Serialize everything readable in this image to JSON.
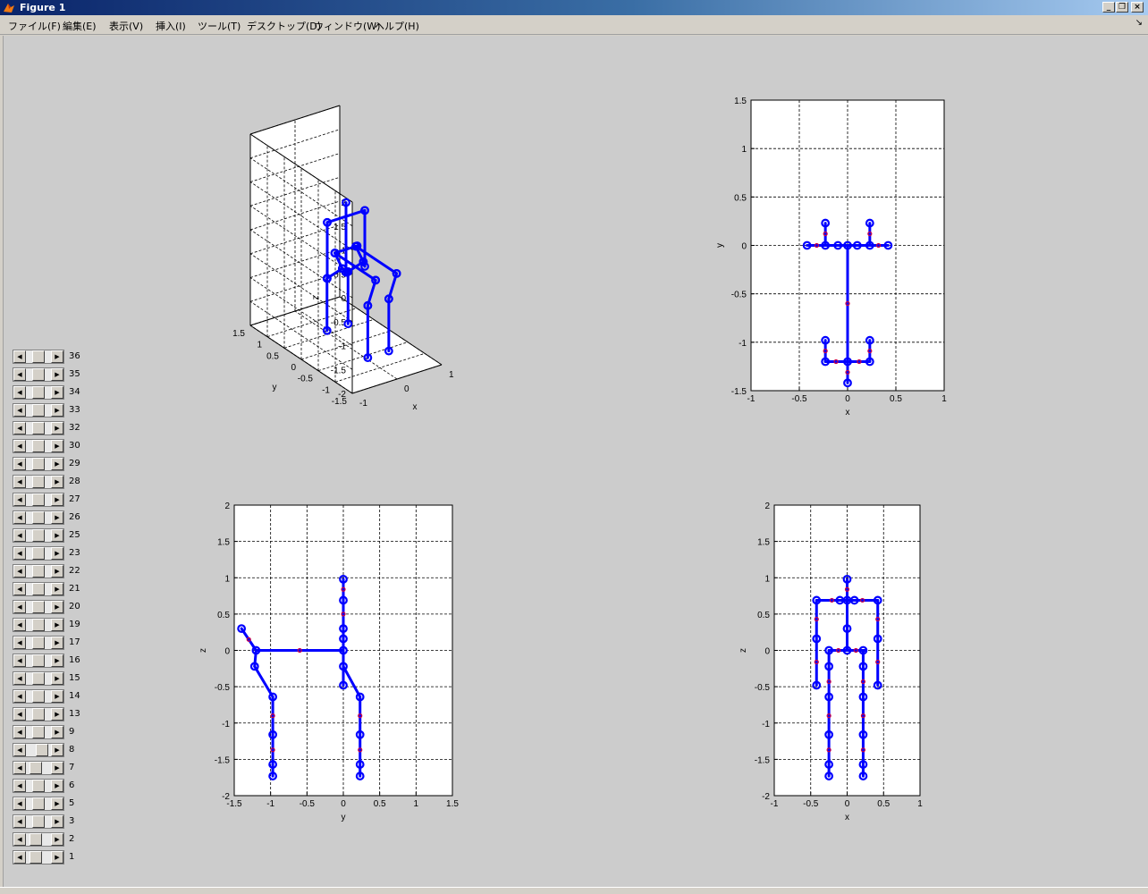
{
  "window": {
    "title": "Figure 1"
  },
  "menu": [
    "ファイル(F)",
    "編集(E)",
    "表示(V)",
    "挿入(I)",
    "ツール(T)",
    "デスクトップ(D)",
    "ウィンドウ(W)",
    "ヘルプ(H)"
  ],
  "colors": {
    "line": "#0000ff",
    "marker": "#0000ff",
    "knot": "#cc0044",
    "axes_bg": "#ffffff",
    "figure_bg": "#cccccc"
  },
  "sliders": [
    {
      "label": "36",
      "value": 0.25
    },
    {
      "label": "35",
      "value": 0.25
    },
    {
      "label": "34",
      "value": 0.25
    },
    {
      "label": "33",
      "value": 0.25
    },
    {
      "label": "32",
      "value": 0.25
    },
    {
      "label": "30",
      "value": 0.25
    },
    {
      "label": "29",
      "value": 0.25
    },
    {
      "label": "28",
      "value": 0.25
    },
    {
      "label": "27",
      "value": 0.25
    },
    {
      "label": "26",
      "value": 0.25
    },
    {
      "label": "25",
      "value": 0.25
    },
    {
      "label": "23",
      "value": 0.25
    },
    {
      "label": "22",
      "value": 0.25
    },
    {
      "label": "21",
      "value": 0.25
    },
    {
      "label": "20",
      "value": 0.25
    },
    {
      "label": "19",
      "value": 0.25
    },
    {
      "label": "17",
      "value": 0.25
    },
    {
      "label": "16",
      "value": 0.25
    },
    {
      "label": "15",
      "value": 0.25
    },
    {
      "label": "14",
      "value": 0.25
    },
    {
      "label": "13",
      "value": 0.25
    },
    {
      "label": "9",
      "value": 0.25
    },
    {
      "label": "8",
      "value": 0.4
    },
    {
      "label": "7",
      "value": 0.15
    },
    {
      "label": "6",
      "value": 0.25
    },
    {
      "label": "5",
      "value": 0.25
    },
    {
      "label": "3",
      "value": 0.25
    },
    {
      "label": "2",
      "value": 0.15
    },
    {
      "label": "1",
      "value": 0.15
    }
  ],
  "chart_data": [
    {
      "type": "scatter",
      "view": "3d",
      "xlabel": "x",
      "ylabel": "y",
      "zlabel": "z",
      "xlim": [
        -1,
        1
      ],
      "ylim": [
        -1.5,
        1.5
      ],
      "zlim": [
        -2,
        2
      ],
      "xticks": [
        "-1",
        "0",
        "1"
      ],
      "yticks": [
        "-1.5",
        "-1",
        "-0.5",
        "0",
        "0.5",
        "1",
        "1.5"
      ],
      "zticks": [
        "-2",
        "-1.5",
        "-1",
        "-0.5",
        "0",
        "0.5",
        "1",
        "1.5",
        "2"
      ],
      "grid": true,
      "points": [
        [
          -0.25,
          0,
          0
        ],
        [
          0.25,
          0,
          0
        ],
        [
          -0.35,
          -0.25,
          0.6
        ],
        [
          0.35,
          -0.25,
          0.6
        ],
        [
          0,
          -1.2,
          0.6
        ],
        [
          0,
          0,
          1
        ],
        [
          -0.25,
          -0.5,
          -1.7
        ],
        [
          0.25,
          -0.5,
          -1.7
        ],
        [
          -0.25,
          1,
          -1.5
        ],
        [
          0.25,
          1,
          -1.5
        ]
      ]
    },
    {
      "type": "line",
      "view": "top",
      "xlabel": "x",
      "ylabel": "y",
      "xlim": [
        -1,
        1
      ],
      "ylim": [
        -1.5,
        1.5
      ],
      "xticks": [
        "-1",
        "-0.5",
        "0",
        "0.5",
        "1"
      ],
      "yticks": [
        "-1.5",
        "-1",
        "-0.5",
        "0",
        "0.5",
        "1",
        "1.5"
      ],
      "grid": true,
      "segments": [
        [
          [
            -0.42,
            0
          ],
          [
            0.42,
            0
          ]
        ],
        [
          [
            -0.23,
            0
          ],
          [
            -0.23,
            0.23
          ]
        ],
        [
          [
            0.23,
            0
          ],
          [
            0.23,
            0.23
          ]
        ],
        [
          [
            0,
            0
          ],
          [
            0,
            -1.2
          ]
        ],
        [
          [
            -0.23,
            -1.2
          ],
          [
            0.23,
            -1.2
          ]
        ],
        [
          [
            -0.23,
            -1.2
          ],
          [
            -0.23,
            -0.98
          ]
        ],
        [
          [
            0.23,
            -1.2
          ],
          [
            0.23,
            -0.98
          ]
        ],
        [
          [
            0,
            -1.2
          ],
          [
            0,
            -1.42
          ]
        ]
      ],
      "markers": [
        [
          -0.42,
          0
        ],
        [
          -0.23,
          0
        ],
        [
          -0.1,
          0
        ],
        [
          0,
          0
        ],
        [
          0.1,
          0
        ],
        [
          0.23,
          0
        ],
        [
          0.42,
          0
        ],
        [
          -0.23,
          0.23
        ],
        [
          0.23,
          0.23
        ],
        [
          -0.23,
          -0.98
        ],
        [
          0.23,
          -0.98
        ],
        [
          -0.23,
          -1.2
        ],
        [
          0,
          -1.2
        ],
        [
          0.23,
          -1.2
        ],
        [
          0,
          -1.42
        ]
      ],
      "knots": [
        [
          -0.32,
          0
        ],
        [
          0.32,
          0
        ],
        [
          0,
          -0.6
        ],
        [
          -0.12,
          -1.2
        ],
        [
          0.12,
          -1.2
        ],
        [
          -0.23,
          0.12
        ],
        [
          0.23,
          0.12
        ],
        [
          -0.23,
          -1.09
        ],
        [
          0.23,
          -1.09
        ],
        [
          0,
          -1.31
        ]
      ]
    },
    {
      "type": "line",
      "view": "side",
      "xlabel": "y",
      "ylabel": "z",
      "xlim": [
        -1.5,
        1.5
      ],
      "ylim": [
        -2,
        2
      ],
      "xticks": [
        "-1.5",
        "-1",
        "-0.5",
        "0",
        "0.5",
        "1",
        "1.5"
      ],
      "yticks": [
        "-2",
        "-1.5",
        "-1",
        "-0.5",
        "0",
        "0.5",
        "1",
        "1.5",
        "2"
      ],
      "grid": true,
      "segments": [
        [
          [
            -1.4,
            0.3
          ],
          [
            -1.2,
            0
          ]
        ],
        [
          [
            -1.2,
            0
          ],
          [
            0,
            0
          ]
        ],
        [
          [
            -1.2,
            0
          ],
          [
            -1.22,
            -0.22
          ]
        ],
        [
          [
            -1.22,
            -0.22
          ],
          [
            -0.97,
            -0.64
          ]
        ],
        [
          [
            -0.97,
            -0.64
          ],
          [
            -0.97,
            -1.73
          ]
        ],
        [
          [
            0,
            0.98
          ],
          [
            0,
            -0.48
          ]
        ],
        [
          [
            0,
            -0.22
          ],
          [
            0.23,
            -0.64
          ]
        ],
        [
          [
            0.23,
            -0.64
          ],
          [
            0.23,
            -1.73
          ]
        ]
      ],
      "markers": [
        [
          -1.4,
          0.3
        ],
        [
          -1.2,
          0
        ],
        [
          -1.22,
          -0.22
        ],
        [
          -0.97,
          -0.64
        ],
        [
          -0.97,
          -1.16
        ],
        [
          -0.97,
          -1.57
        ],
        [
          -0.97,
          -1.73
        ],
        [
          0,
          0.98
        ],
        [
          0,
          0.69
        ],
        [
          0,
          0.3
        ],
        [
          0,
          0.16
        ],
        [
          0,
          0
        ],
        [
          0,
          -0.22
        ],
        [
          0,
          -0.48
        ],
        [
          0.23,
          -0.64
        ],
        [
          0.23,
          -1.16
        ],
        [
          0.23,
          -1.57
        ],
        [
          0.23,
          -1.73
        ]
      ],
      "knots": [
        [
          -0.6,
          0
        ],
        [
          -1.3,
          0.15
        ],
        [
          -0.97,
          -0.9
        ],
        [
          -0.97,
          -1.37
        ],
        [
          0.23,
          -0.9
        ],
        [
          0.23,
          -1.37
        ],
        [
          0,
          0.84
        ],
        [
          0,
          0.5
        ]
      ]
    },
    {
      "type": "line",
      "view": "front",
      "xlabel": "x",
      "ylabel": "z",
      "xlim": [
        -1,
        1
      ],
      "ylim": [
        -2,
        2
      ],
      "xticks": [
        "-1",
        "-0.5",
        "0",
        "0.5",
        "1"
      ],
      "yticks": [
        "-2",
        "-1.5",
        "-1",
        "-0.5",
        "0",
        "0.5",
        "1",
        "1.5",
        "2"
      ],
      "grid": true,
      "segments": [
        [
          [
            0,
            0.98
          ],
          [
            0,
            0
          ]
        ],
        [
          [
            -0.42,
            0.69
          ],
          [
            0.42,
            0.69
          ]
        ],
        [
          [
            -0.42,
            0.69
          ],
          [
            -0.42,
            -0.48
          ]
        ],
        [
          [
            0.42,
            0.69
          ],
          [
            0.42,
            -0.48
          ]
        ],
        [
          [
            -0.25,
            0
          ],
          [
            0.25,
            0
          ]
        ],
        [
          [
            -0.25,
            0
          ],
          [
            -0.25,
            -1.73
          ]
        ],
        [
          [
            0.22,
            0
          ],
          [
            0.22,
            -1.73
          ]
        ]
      ],
      "markers": [
        [
          0,
          0.98
        ],
        [
          0,
          0.69
        ],
        [
          -0.1,
          0.69
        ],
        [
          0.1,
          0.69
        ],
        [
          -0.42,
          0.69
        ],
        [
          0.42,
          0.69
        ],
        [
          -0.42,
          0.16
        ],
        [
          0.42,
          0.16
        ],
        [
          -0.42,
          -0.48
        ],
        [
          0.42,
          -0.48
        ],
        [
          0,
          0.3
        ],
        [
          0,
          0
        ],
        [
          -0.25,
          0
        ],
        [
          0.22,
          0
        ],
        [
          -0.25,
          -0.22
        ],
        [
          0.22,
          -0.22
        ],
        [
          -0.25,
          -0.64
        ],
        [
          0.22,
          -0.64
        ],
        [
          -0.25,
          -1.16
        ],
        [
          0.22,
          -1.16
        ],
        [
          -0.25,
          -1.57
        ],
        [
          0.22,
          -1.57
        ],
        [
          -0.25,
          -1.73
        ],
        [
          0.22,
          -1.73
        ]
      ],
      "knots": [
        [
          0,
          0.84
        ],
        [
          -0.21,
          0.69
        ],
        [
          0.21,
          0.69
        ],
        [
          -0.42,
          0.43
        ],
        [
          0.42,
          0.43
        ],
        [
          -0.42,
          -0.16
        ],
        [
          0.42,
          -0.16
        ],
        [
          -0.12,
          0
        ],
        [
          0.12,
          0
        ],
        [
          -0.25,
          -0.43
        ],
        [
          0.22,
          -0.43
        ],
        [
          -0.25,
          -0.9
        ],
        [
          0.22,
          -0.9
        ],
        [
          -0.25,
          -1.37
        ],
        [
          0.22,
          -1.37
        ]
      ]
    }
  ]
}
